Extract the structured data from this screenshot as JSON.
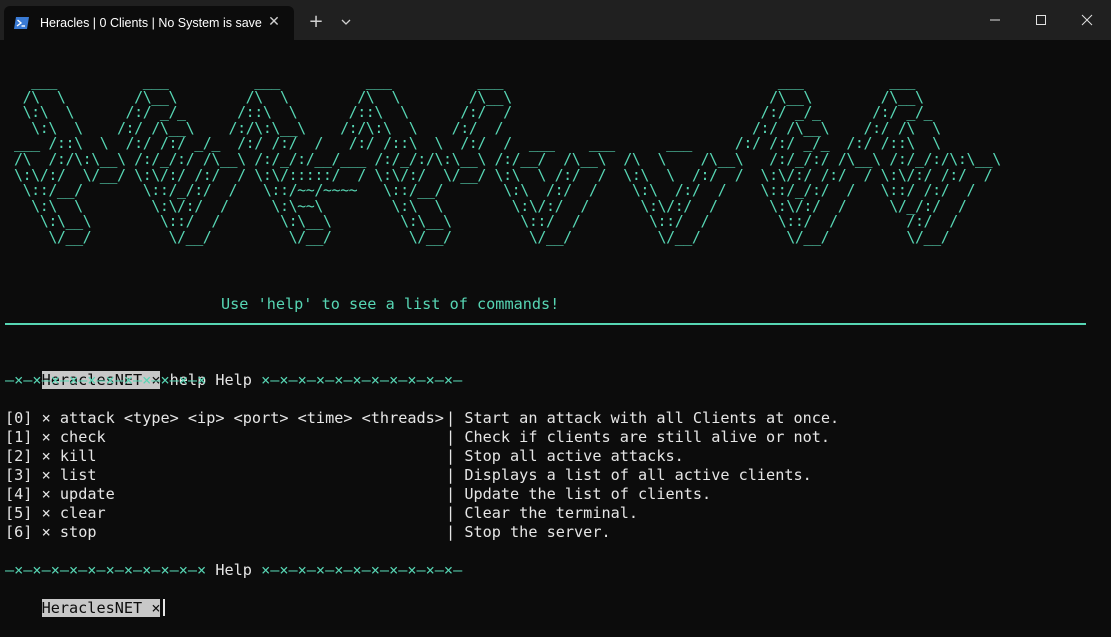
{
  "window": {
    "tab_title": "Heracles | 0 Clients | No System is save",
    "tab_icon": "powershell-icon",
    "new_tab_label": "+",
    "close_glyph": "✕"
  },
  "terminal": {
    "banner_art": "  ___          ___          ___          ___          ___                                ___          ___     \n /\\  \\        /\\__\\        /\\  \\        /\\  \\        /\\__\\                              /\\__\\        /\\__\\    \n \\:\\  \\      /:/ _/_      /::\\  \\      /::\\  \\      /:/  /                             /:/ _/_      /:/ _/_   \n  \\:\\  \\    /:/ /\\__\\    /:/\\:\\__\\    /:/\\:\\  \\    /:/  /                             /:/ /\\__\\    /:/ /\\  \\  \n___ /::\\  \\  /:/ /:/ _/_  /:/ /:/  /   /:/ /::\\  \\  /:/  /  ___    ___      ___     /:/ /:/ _/_  /:/ /::\\  \\ \n/\\  /:/\\:\\__\\ /:/_/:/ /\\__\\ /:/_/:/__/___ /:/_/:/\\:\\__\\ /:/__/  /\\__\\  /\\  \\    /\\__\\   /:/_/:/ /\\__\\ /:/_/:/\\:\\__\\\n\\:\\/:/  \\/__/ \\:\\/:/ /:/  / \\:\\/:::::/  / \\:\\/:/  \\/__/ \\:\\  \\ /:/  /  \\:\\  \\  /:/  /  \\:\\/:/ /:/  / \\:\\/:/ /:/  /\n \\::/__/       \\::/_/:/  /   \\::/~~/~~~~   \\::/__/       \\:\\  /:/  /    \\:\\  /:/  /    \\::/_/:/  /   \\::/ /:/  / \n  \\:\\  \\        \\:\\/:/  /     \\:\\~~\\        \\:\\  \\        \\:\\/:/  /      \\:\\/:/  /      \\:\\/:/  /     \\/_/:/  /  \n   \\:\\__\\        \\::/  /       \\:\\__\\        \\:\\__\\        \\::/  /        \\::/  /        \\::/  /        /:/  /   \n    \\/__/         \\/__/         \\/__/         \\/__/         \\/__/          \\/__/          \\/__/         \\/__/    ",
    "hint": "Use 'help' to see a list of commands!",
    "prompt_name": "HeraclesNET",
    "prompt_sep": "×",
    "command": "help",
    "help_header_left": "—×—×—×—×—×—×—×—×—×—×—×",
    "help_header_label": "Help",
    "help_header_right": "×—×—×—×—×—×—×—×—×—×—×—",
    "commands": [
      {
        "index": "[0]",
        "sep": "×",
        "name": "attack <type> <ip> <port> <time> <threads>",
        "desc": "Start an attack with all Clients at once."
      },
      {
        "index": "[1]",
        "sep": "×",
        "name": "check",
        "desc": "Check if clients are still alive or not."
      },
      {
        "index": "[2]",
        "sep": "×",
        "name": "kill",
        "desc": "Stop all active attacks."
      },
      {
        "index": "[3]",
        "sep": "×",
        "name": "list",
        "desc": "Displays a list of all active clients."
      },
      {
        "index": "[4]",
        "sep": "×",
        "name": "update",
        "desc": "Update the list of clients."
      },
      {
        "index": "[5]",
        "sep": "×",
        "name": "clear",
        "desc": "Clear the terminal."
      },
      {
        "index": "[6]",
        "sep": "×",
        "name": "stop",
        "desc": "Stop the server."
      }
    ],
    "pipe": "|"
  },
  "colors": {
    "accent": "#57d6b4",
    "background": "#0c0c0c",
    "titlebar": "#202020",
    "prompt_bg": "#c8c8c8"
  }
}
